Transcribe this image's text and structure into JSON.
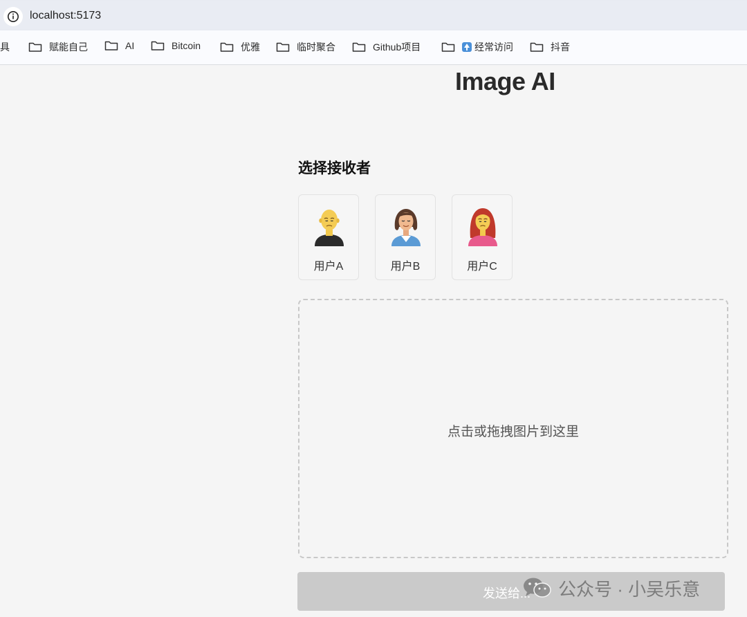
{
  "browser": {
    "url": "localhost:5173",
    "bookmarks": [
      {
        "label": "工具",
        "type": "folder"
      },
      {
        "label": "赋能自己",
        "type": "folder"
      },
      {
        "label": "AI",
        "type": "folder"
      },
      {
        "label": "Bitcoin",
        "type": "folder"
      },
      {
        "label": "优雅",
        "type": "folder"
      },
      {
        "label": "临时聚合",
        "type": "folder"
      },
      {
        "label": "Github项目",
        "type": "folder"
      },
      {
        "label": "经常访问",
        "type": "folder"
      },
      {
        "label": "抖音",
        "type": "folder"
      }
    ]
  },
  "page": {
    "title": "Image AI",
    "receivers_heading": "选择接收者",
    "users": [
      {
        "label": "用户A",
        "avatar": "bald-man-avatar-icon"
      },
      {
        "label": "用户B",
        "avatar": "short-hair-woman-avatar-icon"
      },
      {
        "label": "用户C",
        "avatar": "red-hair-woman-avatar-icon"
      }
    ],
    "dropzone_text": "点击或拖拽图片到这里",
    "send_button_label": "发送给...",
    "watermark": "公众号 · 小吴乐意"
  },
  "colors": {
    "background": "#f5f5f5",
    "send_button_disabled": "#cacaca",
    "dropzone_border": "#c8c8c8"
  }
}
